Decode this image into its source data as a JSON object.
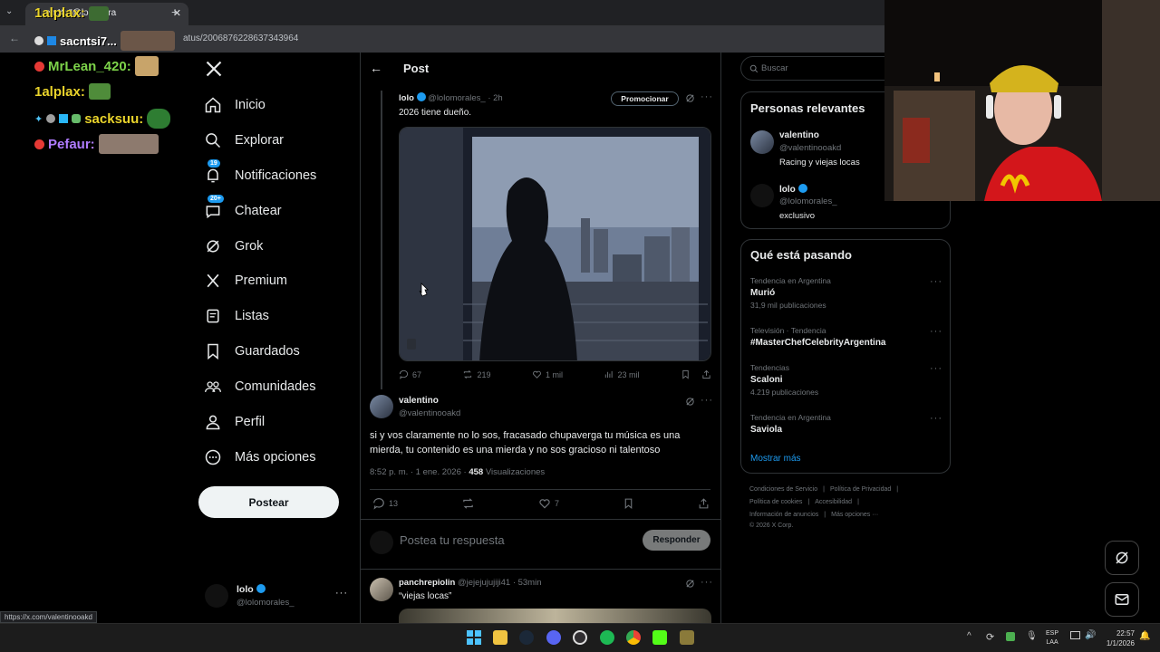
{
  "browser": {
    "tab_title": "en X: \"@lolomora",
    "url": "atus/2006876228637343964",
    "status_url": "https://x.com/valentinooakd"
  },
  "chat_overlay": {
    "lines": [
      {
        "user": "1alplax:",
        "color": "#e9d32b"
      },
      {
        "user": "sacntsi7...",
        "color": "#ffffff"
      },
      {
        "user": "MrLean_420:",
        "color": "#7dd34a"
      },
      {
        "user": "1alplax:",
        "color": "#e9d32b"
      },
      {
        "user": "sacksuu:",
        "color": "#e9d32b"
      },
      {
        "user": "Pefaur:",
        "color": "#b07cff"
      }
    ]
  },
  "nav": {
    "items": [
      {
        "label": "Inicio",
        "icon": "home-icon"
      },
      {
        "label": "Explorar",
        "icon": "search-icon"
      },
      {
        "label": "Notificaciones",
        "icon": "bell-icon",
        "badge": "19"
      },
      {
        "label": "Chatear",
        "icon": "chat-icon",
        "badge": "20+"
      },
      {
        "label": "Grok",
        "icon": "grok-icon"
      },
      {
        "label": "Premium",
        "icon": "x-logo-icon"
      },
      {
        "label": "Listas",
        "icon": "list-icon"
      },
      {
        "label": "Guardados",
        "icon": "bookmark-icon"
      },
      {
        "label": "Comunidades",
        "icon": "communities-icon"
      },
      {
        "label": "Perfil",
        "icon": "person-icon"
      },
      {
        "label": "Más opciones",
        "icon": "more-circle-icon"
      }
    ],
    "post_button": "Postear",
    "account": {
      "name": "lolo",
      "handle": "@lolomorales_"
    }
  },
  "main": {
    "header_title": "Post",
    "quoted": {
      "name": "lolo",
      "handle": "@lolomorales_",
      "time": "· 2h",
      "promo_label": "Promocionar",
      "text": "2026 tiene dueño.",
      "stats": {
        "replies": "67",
        "reposts": "219",
        "likes": "1 mil",
        "views": "23 mil"
      }
    },
    "post": {
      "name": "valentino",
      "handle": "@valentinooakd",
      "text": "si y vos claramente no lo sos, fracasado chupaverga tu música es una mierda, tu contenido es una mierda y no sos gracioso ni talentoso",
      "timestamp": "8:52 p. m. · 1 ene. 2026 ·",
      "views_count": "458",
      "views_label": "Visualizaciones",
      "stats": {
        "replies": "13",
        "likes": "7"
      }
    },
    "reply_box": {
      "placeholder": "Postea tu respuesta",
      "button": "Responder"
    },
    "next_reply": {
      "name": "panchrepiolin",
      "handle": "@jejejujujiji41",
      "time": "· 53min",
      "text": "“viejas locas”"
    }
  },
  "right": {
    "search_placeholder": "Buscar",
    "relevant": {
      "title": "Personas relevantes",
      "people": [
        {
          "name": "valentino",
          "handle": "@valentinooakd",
          "bio": "Racing y viejas locas",
          "verified": false
        },
        {
          "name": "lolo",
          "handle": "@lolomorales_",
          "bio": "exclusivo",
          "verified": true
        }
      ]
    },
    "trending": {
      "title": "Qué está pasando",
      "items": [
        {
          "meta": "Tendencia en Argentina",
          "title": "Murió",
          "count": "31,9 mil publicaciones"
        },
        {
          "meta": "Televisión · Tendencia",
          "title": "#MasterChefCelebrityArgentina",
          "count": ""
        },
        {
          "meta": "Tendencias",
          "title": "Scaloni",
          "count": "4.219 publicaciones"
        },
        {
          "meta": "Tendencia en Argentina",
          "title": "Saviola",
          "count": ""
        }
      ],
      "show_more": "Mostrar más"
    },
    "footer": {
      "row1": [
        "Condiciones de Servicio",
        "|",
        "Política de Privacidad",
        "|"
      ],
      "row2": [
        "Política de cookies",
        "|",
        "Accesibilidad",
        "|"
      ],
      "row3": [
        "Información de anuncios",
        "|",
        "Más opciones ···"
      ],
      "copyright": "© 2026 X Corp."
    }
  },
  "taskbar": {
    "lang": "ESP",
    "lang2": "LAA",
    "time": "22:57",
    "date": "1/1/2026"
  },
  "colors": {
    "accent": "#1d9bf0",
    "background": "#000000",
    "text": "#e7e9ea",
    "muted": "#71767b"
  }
}
